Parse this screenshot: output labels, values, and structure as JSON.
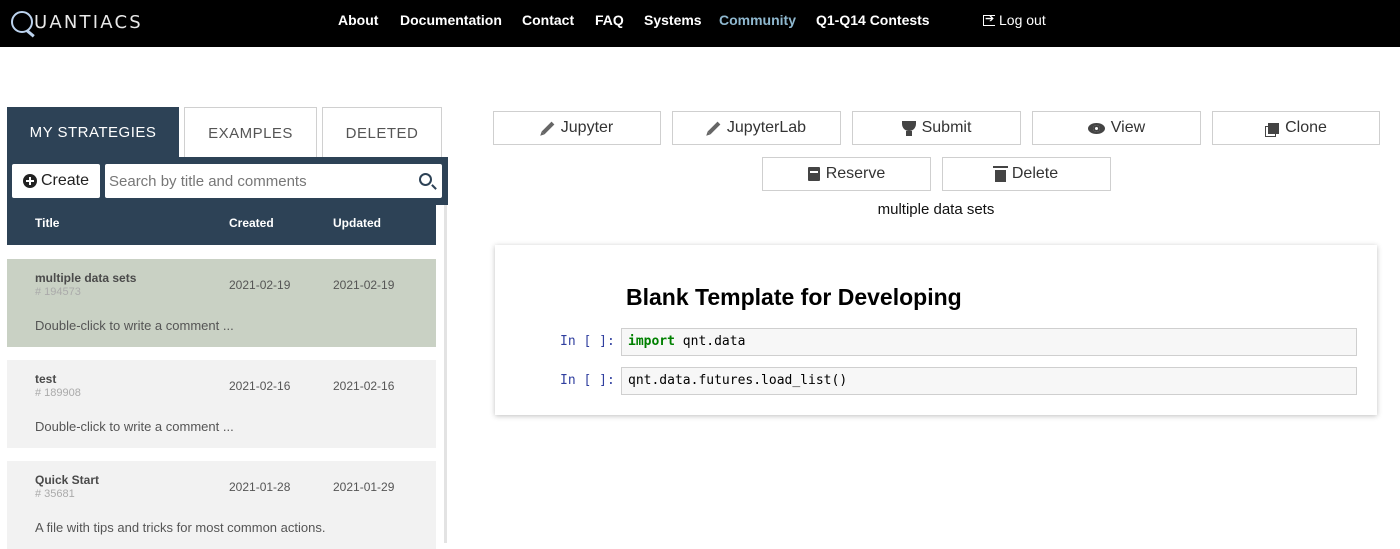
{
  "brand": {
    "logo_text": "UANTIACS"
  },
  "nav": {
    "items": [
      {
        "label": "About"
      },
      {
        "label": "Documentation"
      },
      {
        "label": "Contact"
      },
      {
        "label": "FAQ"
      },
      {
        "label": "Systems"
      },
      {
        "label": "Community"
      },
      {
        "label": "Q1-Q14 Contests"
      }
    ],
    "logout_label": "Log out"
  },
  "tabs": [
    {
      "label": "MY STRATEGIES",
      "active": true
    },
    {
      "label": "EXAMPLES",
      "active": false
    },
    {
      "label": "DELETED",
      "active": false
    }
  ],
  "toolbar": {
    "create_label": "Create",
    "search_placeholder": "Search by title and comments"
  },
  "columns": {
    "title": "Title",
    "created": "Created",
    "updated": "Updated"
  },
  "strategies": [
    {
      "title": "multiple data sets",
      "id": "# 194573",
      "created": "2021-02-19",
      "updated": "2021-02-19",
      "comment": "Double-click to write a comment ...",
      "selected": true
    },
    {
      "title": "test",
      "id": "# 189908",
      "created": "2021-02-16",
      "updated": "2021-02-16",
      "comment": "Double-click to write a comment ...",
      "selected": false
    },
    {
      "title": "Quick Start",
      "id": "# 35681",
      "created": "2021-01-28",
      "updated": "2021-01-29",
      "comment": "A file with tips and tricks for most common actions.",
      "selected": false
    }
  ],
  "actions": {
    "jupyter": "Jupyter",
    "jupyterlab": "JupyterLab",
    "submit": "Submit",
    "view": "View",
    "clone": "Clone",
    "reserve": "Reserve",
    "delete": "Delete"
  },
  "selected_name": "multiple data sets",
  "notebook": {
    "heading": "Blank Template for Developing",
    "prompt": "In [ ]:",
    "cell1_keyword": "import",
    "cell1_rest": " qnt.data",
    "cell2": "qnt.data.futures.load_list()"
  },
  "colors": {
    "nav_bg": "#000000",
    "panel_dark": "#2d4256",
    "selected_row": "#c9d1c4",
    "nav_dim": "#8fb8cf"
  }
}
